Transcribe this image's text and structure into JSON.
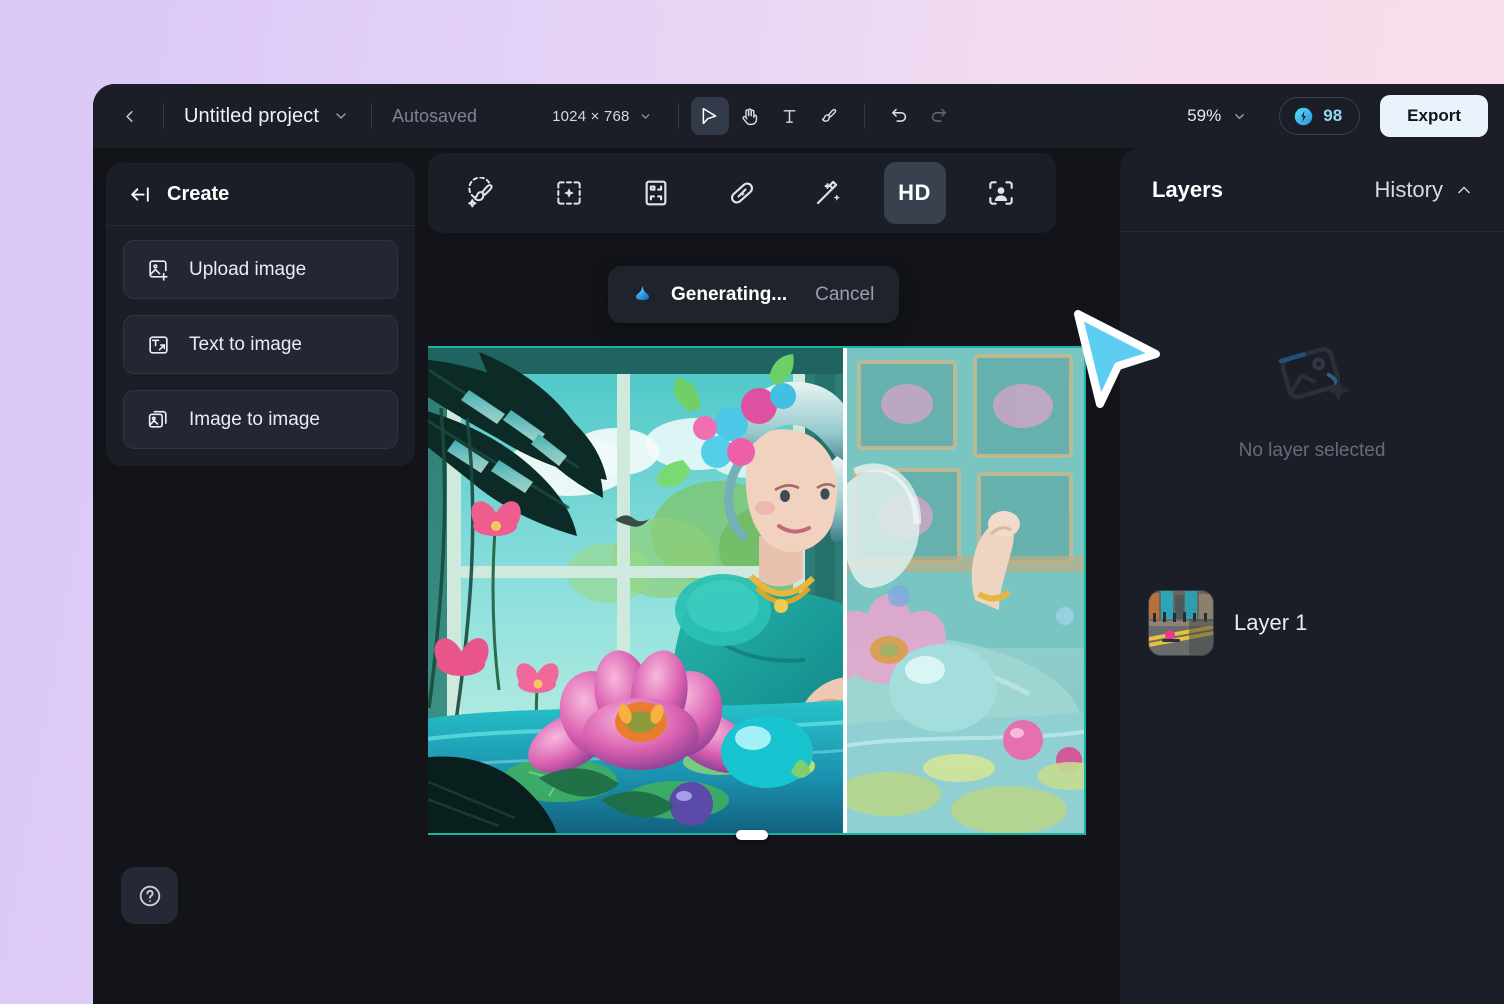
{
  "topbar": {
    "back_icon": "chevron-left-icon",
    "project_title": "Untitled project",
    "project_dropdown_icon": "chevron-down-icon",
    "autosaved_label": "Autosaved",
    "canvas_size": "1024 × 768",
    "size_dropdown_icon": "chevron-down-icon",
    "tools": [
      {
        "name": "select-tool",
        "icon": "cursor-arrow-icon",
        "active": true
      },
      {
        "name": "hand-tool",
        "icon": "hand-icon",
        "active": false
      },
      {
        "name": "text-tool",
        "icon": "text-t-icon",
        "active": false
      },
      {
        "name": "brush-tool",
        "icon": "brush-icon",
        "active": false
      },
      {
        "name": "undo",
        "icon": "undo-arrow-icon",
        "active": false
      },
      {
        "name": "redo",
        "icon": "redo-arrow-icon",
        "active": false
      }
    ],
    "zoom_level": "59%",
    "zoom_dropdown_icon": "chevron-down-icon",
    "credits": "98",
    "credits_icon": "credit-coin-icon",
    "export_label": "Export"
  },
  "sidebar": {
    "collapse_icon": "collapse-left-icon",
    "title": "Create",
    "items": [
      {
        "label": "Upload image",
        "icon": "image-plus-icon"
      },
      {
        "label": "Text to image",
        "icon": "text-to-image-icon"
      },
      {
        "label": "Image to image",
        "icon": "image-stack-icon"
      }
    ],
    "help_icon": "question-circle-icon"
  },
  "canvas_toolbar": {
    "tools": [
      {
        "name": "ai-retouch",
        "icon": "magic-brush-icon",
        "label": "",
        "active": false
      },
      {
        "name": "generative-fill",
        "icon": "selection-sparkle-icon",
        "label": "",
        "active": false
      },
      {
        "name": "expand-canvas",
        "icon": "expand-frame-icon",
        "label": "",
        "active": false
      },
      {
        "name": "object-remove",
        "icon": "eraser-patch-icon",
        "label": "",
        "active": false
      },
      {
        "name": "magic-enhance",
        "icon": "magic-wand-icon",
        "label": "",
        "active": false
      },
      {
        "name": "hd-upscale",
        "icon": "hd-text-icon",
        "label": "HD",
        "active": true
      },
      {
        "name": "portrait-enhance",
        "icon": "person-focus-icon",
        "label": "",
        "active": false
      }
    ]
  },
  "toast": {
    "icon": "generating-spinner-icon",
    "status_label": "Generating...",
    "cancel_label": "Cancel"
  },
  "right_panel": {
    "title": "Layers",
    "history_label": "History",
    "history_chevron_icon": "chevron-up-icon",
    "empty_icon": "no-layer-image-icon",
    "empty_label": "No layer selected",
    "layers": [
      {
        "name": "Layer 1",
        "thumb": "street-scene-thumbnail"
      }
    ]
  },
  "cursor": {
    "icon": "arrow-pointer-cursor",
    "color": "#5ecdf2"
  },
  "colors": {
    "accent_cyan": "#5ecdf2",
    "selection_teal": "#1ab5a0",
    "panel_bg": "#1b1e26",
    "app_bg": "#121419",
    "export_bg": "#eaf3fb",
    "backdrop_left": "#d9c7f5",
    "backdrop_right": "#fcdde8"
  }
}
